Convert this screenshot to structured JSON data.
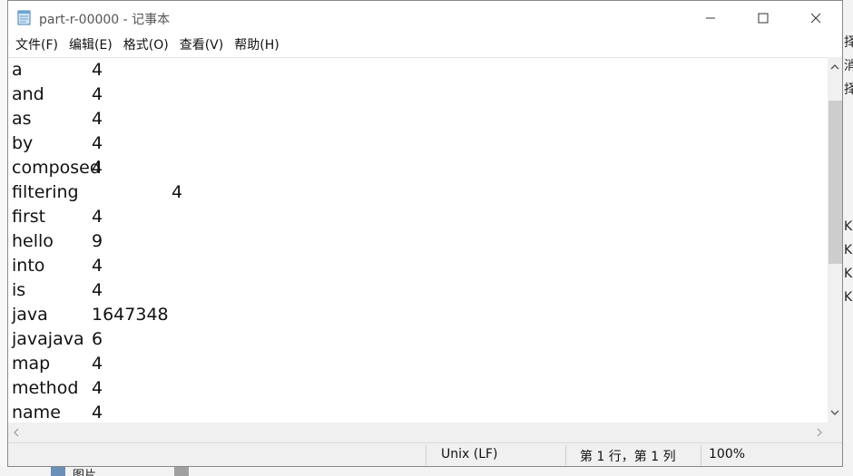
{
  "window": {
    "title": "part-r-00000 - 记事本"
  },
  "menu": [
    "文件(F)",
    "编辑(E)",
    "格式(O)",
    "查看(V)",
    "帮助(H)"
  ],
  "content": {
    "lines": [
      {
        "word": "a",
        "count": "4"
      },
      {
        "word": "and",
        "count": "4"
      },
      {
        "word": "as",
        "count": "4"
      },
      {
        "word": "by",
        "count": "4"
      },
      {
        "word": "composed",
        "count": "4"
      },
      {
        "word": "filtering",
        "count": "4"
      },
      {
        "word": "first",
        "count": "4"
      },
      {
        "word": "hello",
        "count": "9"
      },
      {
        "word": "into",
        "count": "4"
      },
      {
        "word": "is",
        "count": "4"
      },
      {
        "word": "java",
        "count": "1647348"
      },
      {
        "word": "javajava",
        "count": "6"
      },
      {
        "word": "map",
        "count": "4"
      },
      {
        "word": "method",
        "count": "4"
      },
      {
        "word": "name",
        "count": "4"
      }
    ]
  },
  "status": {
    "line_ending": "Unix (LF)",
    "position": "第 1 行，第 1 列",
    "zoom": "100%"
  },
  "background": {
    "right_fragments": [
      "择",
      "消",
      "择",
      "KE",
      "KE",
      "KE",
      "KE"
    ],
    "bottom_label": "图片"
  },
  "colors": {
    "thumb": "#cdcdcd",
    "scroll_track": "#f0f0f0",
    "status_bar": "#f0f0f0"
  }
}
